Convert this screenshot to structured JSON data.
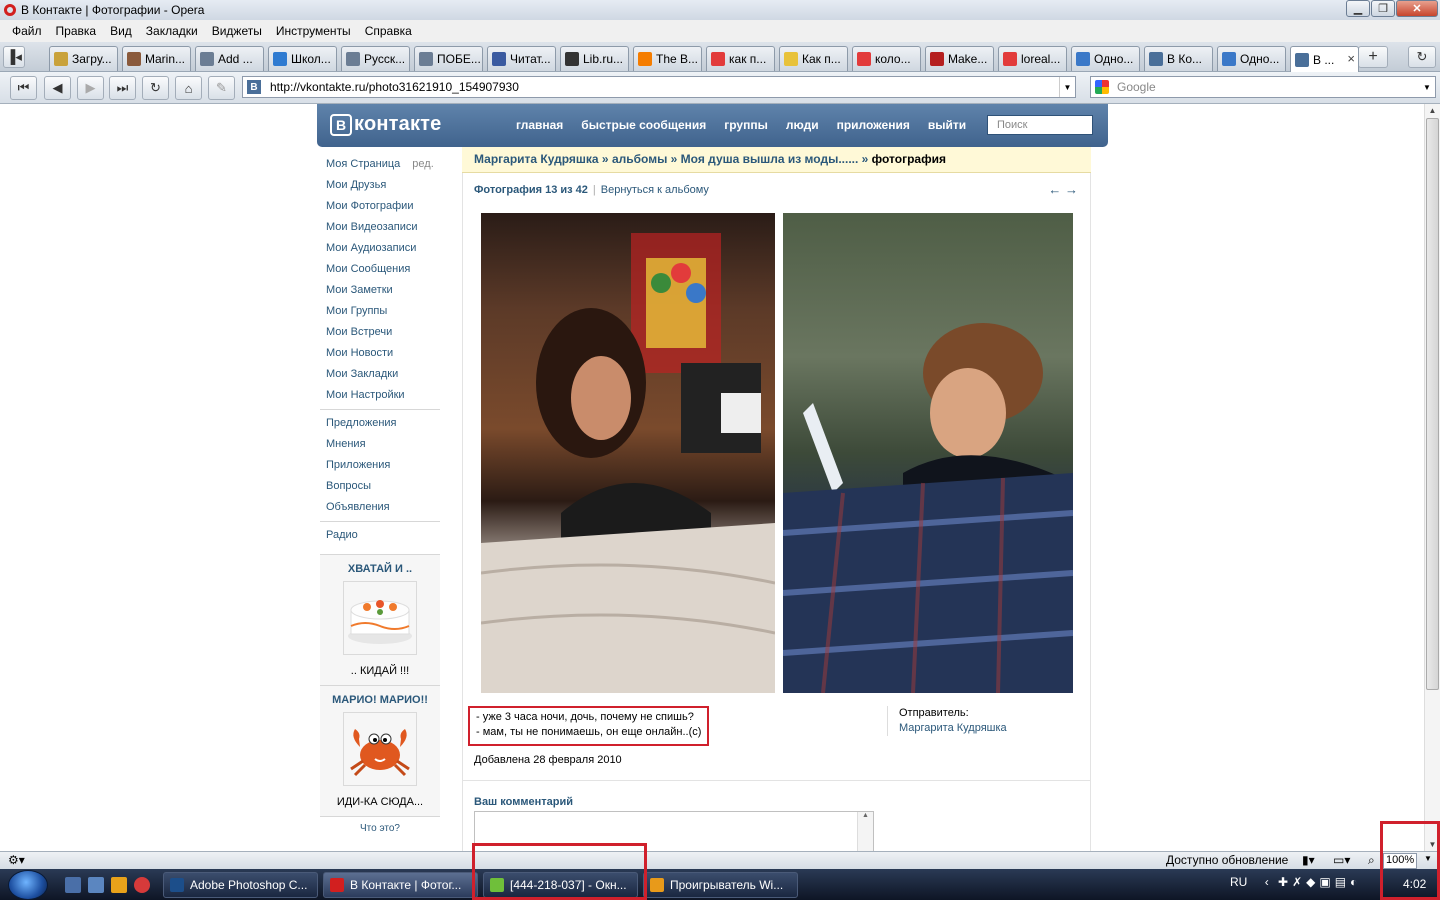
{
  "window": {
    "title": "В Контакте | Фотографии - Opera"
  },
  "menu": [
    "Файл",
    "Правка",
    "Вид",
    "Закладки",
    "Виджеты",
    "Инструменты",
    "Справка"
  ],
  "tabs": [
    {
      "label": "Загру...",
      "color": "#c9a23b"
    },
    {
      "label": "Marin...",
      "color": "#8a5a3c"
    },
    {
      "label": "Add ...",
      "color": "#6b7d94"
    },
    {
      "label": "Школ...",
      "color": "#2f7bd1"
    },
    {
      "label": "Русск...",
      "color": "#6b7d94"
    },
    {
      "label": "ПОБЕ...",
      "color": "#6b7d94"
    },
    {
      "label": "Читат...",
      "color": "#3a5aa0"
    },
    {
      "label": "Lib.ru...",
      "color": "#333333"
    },
    {
      "label": "The B...",
      "color": "#f57d00"
    },
    {
      "label": "как п...",
      "color": "#e23b3b"
    },
    {
      "label": "Как п...",
      "color": "#e8c23a"
    },
    {
      "label": "коло...",
      "color": "#e23b3b"
    },
    {
      "label": "Make...",
      "color": "#b51f1f"
    },
    {
      "label": "loreal...",
      "color": "#e23b3b"
    },
    {
      "label": "Одно...",
      "color": "#3a78c8"
    },
    {
      "label": "В Ко...",
      "color": "#4a6f99"
    },
    {
      "label": "Одно...",
      "color": "#3a78c8"
    },
    {
      "label": "В ...",
      "color": "#4a6f99"
    }
  ],
  "address": {
    "url": "http://vkontakte.ru/photo31621910_154907930",
    "search_placeholder": "Google"
  },
  "vk": {
    "logo": "контакте",
    "logo_letter": "В",
    "nav": [
      "главная",
      "быстрые сообщения",
      "группы",
      "люди",
      "приложения",
      "выйти"
    ],
    "search_placeholder": "Поиск"
  },
  "sidebar": {
    "edit": "ред.",
    "group1": [
      "Моя Страница",
      "Мои Друзья",
      "Мои Фотографии",
      "Мои Видеозаписи",
      "Мои Аудиозаписи",
      "Мои Сообщения",
      "Мои Заметки",
      "Мои Группы",
      "Мои Встречи",
      "Мои Новости",
      "Мои Закладки",
      "Мои Настройки"
    ],
    "group2": [
      "Предложения",
      "Мнения",
      "Приложения",
      "Вопросы",
      "Объявления"
    ],
    "group3": [
      "Радио"
    ],
    "ad1": {
      "title": "ХВАТАЙ И ..",
      "caption": ".. КИДАЙ !!!"
    },
    "ad2": {
      "title": "МАРИО! МАРИО!!",
      "caption": "ИДИ-КА СЮДА..."
    },
    "what": "Что это?"
  },
  "breadcrumb": {
    "owner": "Маргарита Кудряшка",
    "sep": " » ",
    "albums": "альбомы",
    "album": "Моя душа вышла из моды......",
    "current": "фотография"
  },
  "photo": {
    "counter": "Фотография 13 из 42",
    "back": "Вернуться к альбому",
    "arrows": "← →",
    "caption_line1": "- уже 3 часа ночи, дочь, почему не спишь?",
    "caption_line2": "- мам, ты не понимаешь, он еще онлайн..(с)",
    "added": "Добавлена 28 февраля 2010",
    "sender_label": "Отправитель:",
    "sender_name": "Маргарита Кудряшка"
  },
  "comment": {
    "label": "Ваш комментарий"
  },
  "statusbar": {
    "update": "Доступно обновление",
    "zoom": "100%"
  },
  "taskbar": {
    "tasks": [
      {
        "label": "Adobe Photoshop C...",
        "color": "#1c4e8a"
      },
      {
        "label": "В Контакте | Фотог...",
        "color": "#d21f1f"
      },
      {
        "label": "[444-218-037] - Окн...",
        "color": "#6fbf3a"
      },
      {
        "label": "Проигрыватель Wi...",
        "color": "#e89a1a"
      }
    ],
    "lang": "RU",
    "clock": "4:02"
  }
}
